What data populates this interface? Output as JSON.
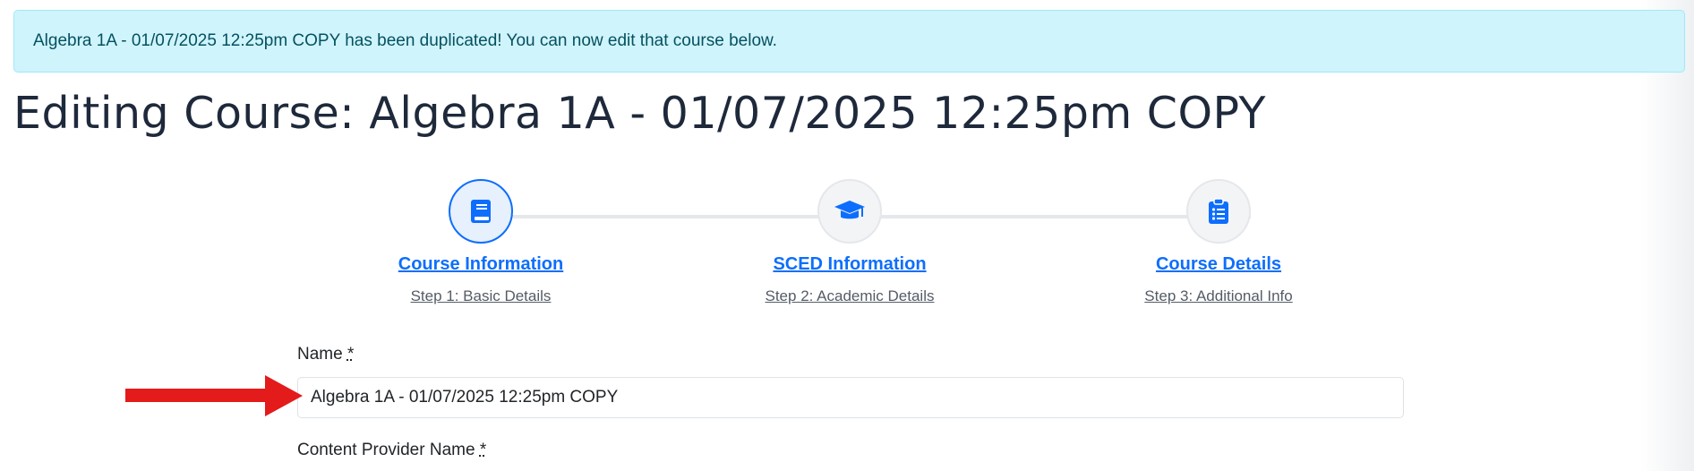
{
  "alert": {
    "message": "Algebra 1A - 01/07/2025 12:25pm COPY has been duplicated! You can now edit that course below."
  },
  "page": {
    "title": "Editing Course: Algebra 1A - 01/07/2025 12:25pm COPY"
  },
  "stepper": {
    "steps": [
      {
        "title": "Course Information",
        "subtitle": "Step 1: Basic Details",
        "icon": "book-icon",
        "active": true
      },
      {
        "title": "SCED Information",
        "subtitle": "Step 2: Academic Details",
        "icon": "graduation-cap-icon",
        "active": false
      },
      {
        "title": "Course Details",
        "subtitle": "Step 3: Additional Info",
        "icon": "clipboard-list-icon",
        "active": false
      }
    ]
  },
  "form": {
    "name_label": "Name",
    "name_value": "Algebra 1A - 01/07/2025 12:25pm COPY",
    "content_provider_label": "Content Provider Name",
    "required_marker": "*"
  },
  "annotation": {
    "arrow_color": "#e31b1b",
    "arrow_icon": "red-arrow-pointer"
  },
  "colors": {
    "accent": "#0d6efd",
    "alert_bg": "#cff4fc",
    "alert_text": "#055160"
  }
}
